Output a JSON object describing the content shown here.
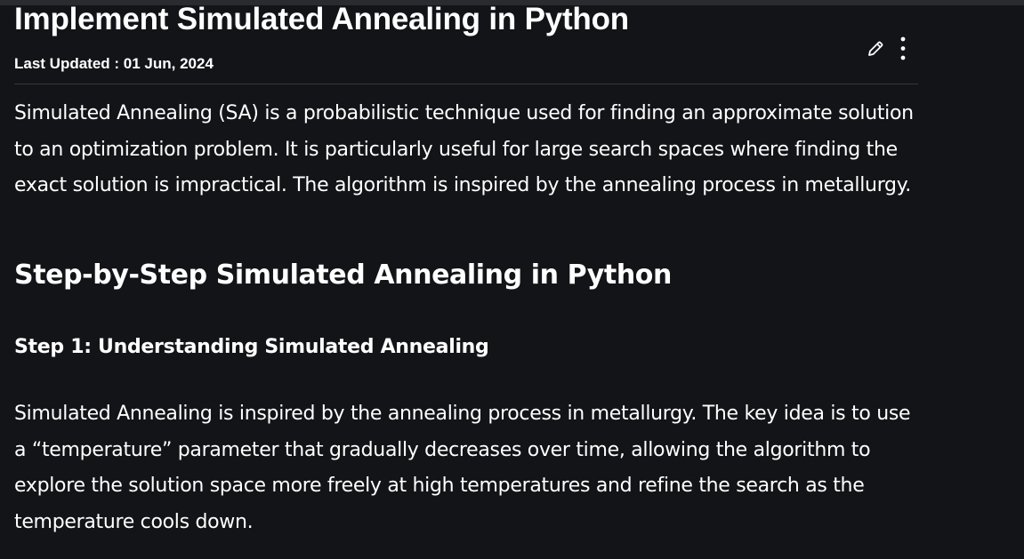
{
  "article": {
    "title": "Implement Simulated Annealing in Python",
    "last_updated": "Last Updated : 01 Jun, 2024",
    "intro": "Simulated Annealing (SA) is a probabilistic technique used for finding an approximate solution to an optimization problem. It is particularly useful for large search spaces where finding the exact solution is impractical. The algorithm is inspired by the annealing process in metallurgy.",
    "section_heading": "Step-by-Step Simulated Annealing in Python",
    "step1_heading": "Step 1: Understanding Simulated Annealing",
    "step1_text": "Simulated Annealing is inspired by the annealing process in metallurgy. The key idea is to use a “temperature” parameter that gradually decreases over time, allowing the algorithm to explore the solution space more freely at high temperatures and refine the search as the temperature cools down."
  },
  "actions": {
    "edit_icon": "pencil-icon",
    "more_icon": "vertical-dots-icon"
  },
  "colors": {
    "background": "#131417",
    "text": "#ffffff",
    "divider": "#34363b"
  }
}
